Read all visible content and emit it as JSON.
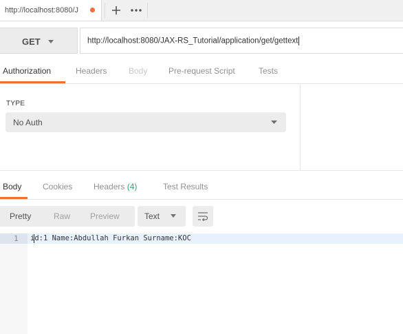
{
  "tab": {
    "title": "http://localhost:8080/J",
    "modified_color": "#f26b3a",
    "new_tab_icon": "plus-icon",
    "more_icon": "ellipsis-icon"
  },
  "request": {
    "method": "GET",
    "url": "http://localhost:8080/JAX-RS_Tutorial/application/get/gettext"
  },
  "request_tabs": [
    {
      "label": "Authorization",
      "active": true
    },
    {
      "label": "Headers",
      "active": false
    },
    {
      "label": "Body",
      "active": false,
      "disabled": true
    },
    {
      "label": "Pre-request Script",
      "active": false
    },
    {
      "label": "Tests",
      "active": false
    }
  ],
  "auth": {
    "type_label": "TYPE",
    "selected": "No Auth"
  },
  "response_tabs": [
    {
      "label": "Body",
      "active": true
    },
    {
      "label": "Cookies",
      "active": false
    },
    {
      "label": "Headers",
      "count": "(4)",
      "active": false
    },
    {
      "label": "Test Results",
      "active": false
    }
  ],
  "response_toolbar": {
    "formats": [
      "Pretty",
      "Raw",
      "Preview"
    ],
    "type_selected": "Text",
    "wrap_icon": "wrap-lines-icon"
  },
  "response_body": {
    "line_number": "1",
    "text": "id:1 Name:Abdullah Furkan Surname:KOC"
  },
  "colors": {
    "accent": "#f26b3a",
    "count_green": "#2ea86f"
  }
}
